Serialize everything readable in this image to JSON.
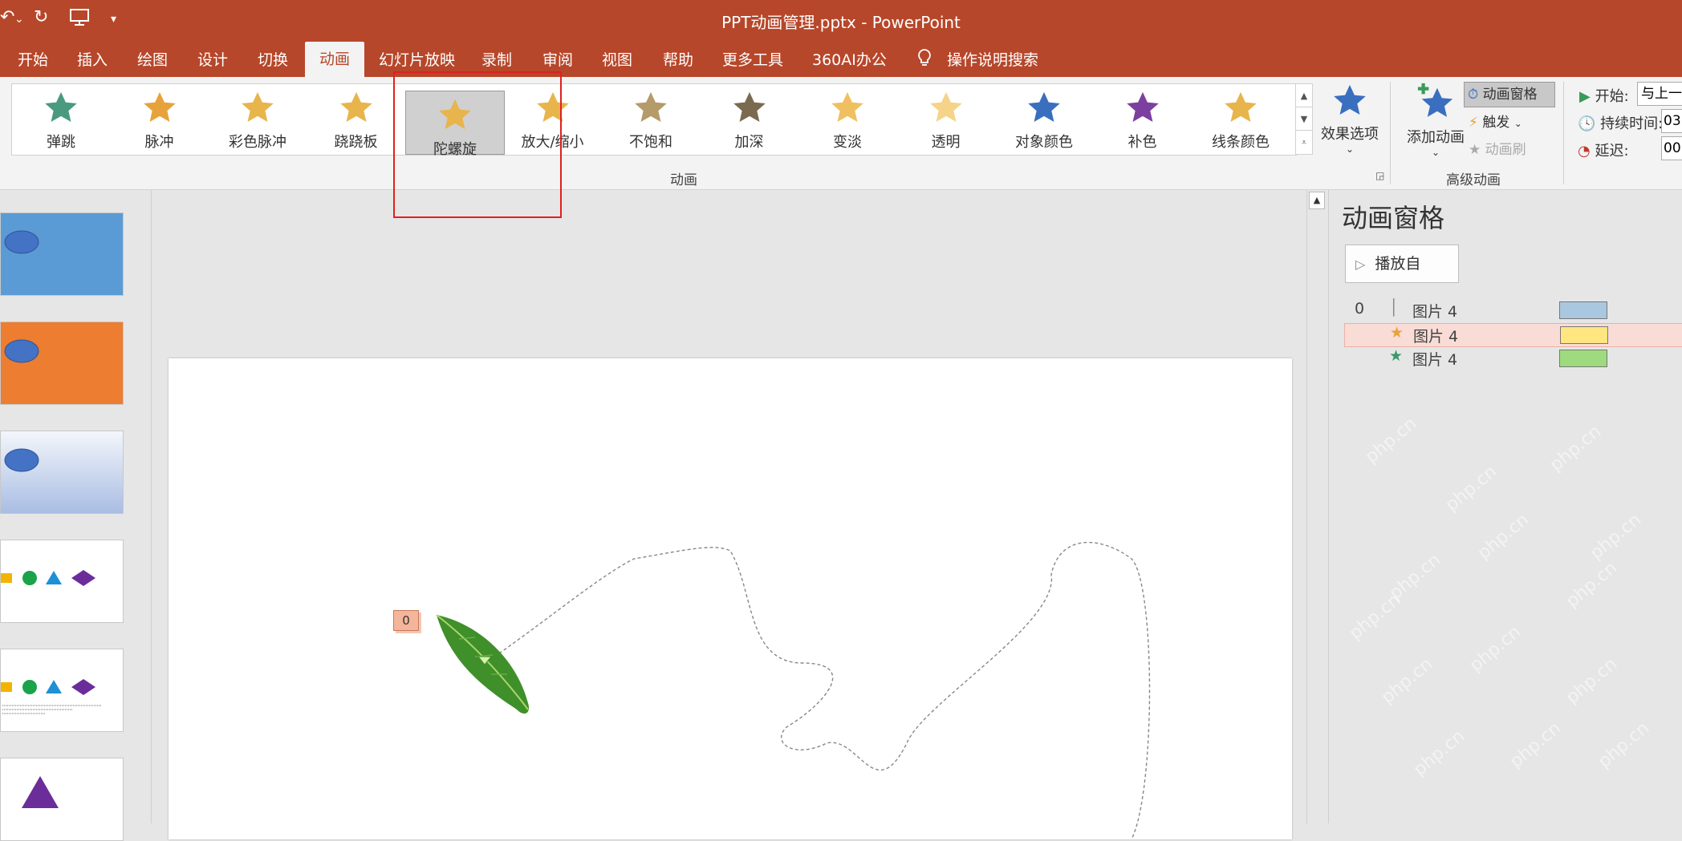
{
  "window": {
    "title": "PPT动画管理.pptx  -  PowerPoint"
  },
  "quick_access": {
    "undo_icon": "undo-icon",
    "redo_icon": "redo-icon",
    "present_icon": "present-icon",
    "customize": "▾"
  },
  "tabs": [
    "开始",
    "插入",
    "绘图",
    "设计",
    "切换",
    "动画",
    "幻灯片放映",
    "录制",
    "审阅",
    "视图",
    "帮助",
    "更多工具",
    "360AI办公"
  ],
  "active_tab": "动画",
  "search": {
    "label": "操作说明搜索"
  },
  "animations": [
    {
      "label": "弹跳",
      "color": "#4a9a7f"
    },
    {
      "label": "脉冲",
      "color": "#e8a23c"
    },
    {
      "label": "彩色脉冲",
      "color": "#e8b44c"
    },
    {
      "label": "跷跷板",
      "color": "#e8b44c"
    },
    {
      "label": "陀螺旋",
      "color": "#e8b44c",
      "selected": true
    },
    {
      "label": "放大/缩小",
      "color": "#e8b44c"
    },
    {
      "label": "不饱和",
      "color": "#b59a6a"
    },
    {
      "label": "加深",
      "color": "#7a6a50"
    },
    {
      "label": "变淡",
      "color": "#f0c060"
    },
    {
      "label": "透明",
      "color": "#f5d48a"
    },
    {
      "label": "对象颜色",
      "color": "#3a6fbf"
    },
    {
      "label": "补色",
      "color": "#7c3fa0"
    },
    {
      "label": "线条颜色",
      "color": "#e8b44c"
    }
  ],
  "ribbon": {
    "group_animation": "动画",
    "group_advanced": "高级动画",
    "effect_options": "效果选项",
    "add_animation": "添加动画",
    "animation_pane": "动画窗格",
    "trigger": "触发",
    "animation_painter": "动画刷",
    "start_label": "开始:",
    "start_value": "与上一",
    "duration_label": "持续时间:",
    "duration_value": "03",
    "delay_label": "延迟:",
    "delay_value": "00"
  },
  "slide": {
    "anim_tag": "0"
  },
  "pane": {
    "title": "动画窗格",
    "play_from": "播放自",
    "items": [
      {
        "index": "0",
        "name": "图片 4",
        "bar_color": "#a9c8e0"
      },
      {
        "index": "",
        "name": "图片 4",
        "bar_color": "#ffe680"
      },
      {
        "index": "",
        "name": "图片 4",
        "bar_color": "#9edb7e"
      }
    ]
  },
  "watermark": "php.cn"
}
